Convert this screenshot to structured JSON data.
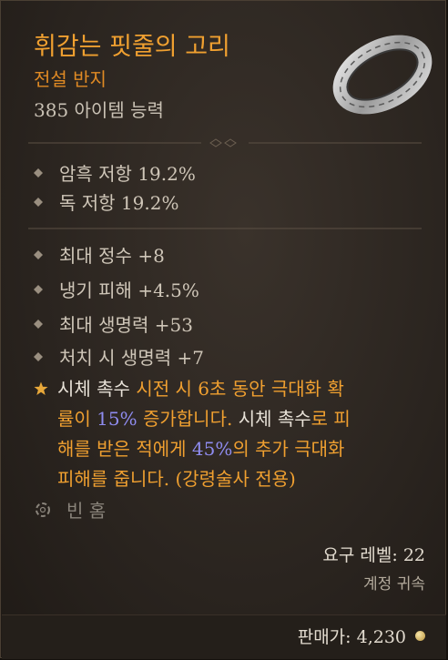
{
  "item": {
    "name": "휘감는 핏줄의 고리",
    "rarity": "전설 반지",
    "item_power": "385 아이템 능력"
  },
  "implicits": [
    {
      "label": "암흑 저항 19.2%"
    },
    {
      "label": "독 저항 19.2%"
    }
  ],
  "affixes": [
    {
      "label": "최대 정수 +8"
    },
    {
      "label": "냉기 피해 +4.5%"
    },
    {
      "label": "최대 생명력 +53"
    },
    {
      "label": "처치 시 생명력 +7"
    }
  ],
  "legendary": {
    "line1_white": "시체 촉수",
    "line1_orange": " 시전 시 6초 동안 극대화 확",
    "line2_a": "률이 ",
    "line2_blue": "15%",
    "line2_b": " 증가합니다. ",
    "line2_white": "시체 촉수",
    "line2_c": "로 피",
    "line3_a": "해를 받은 적에게 ",
    "line3_blue": "45%",
    "line3_b": "의 추가 극대화",
    "line4": "피해를 줍니다. (강령술사 전용)"
  },
  "socket": {
    "label": "빈 홈"
  },
  "requirements": {
    "level": "요구 레벨: 22",
    "binding": "계정 귀속"
  },
  "sell": {
    "label": "판매가: 4,230"
  },
  "colors": {
    "legendary_orange": "#f0a030",
    "value_blue": "#8f8cf0",
    "body_text": "#cfc6b8"
  },
  "icons": {
    "bullet": "diamond-bullet-icon",
    "legendary": "star-icon",
    "socket": "empty-socket-icon",
    "currency": "gold-coin-icon",
    "item": "ring-icon"
  }
}
